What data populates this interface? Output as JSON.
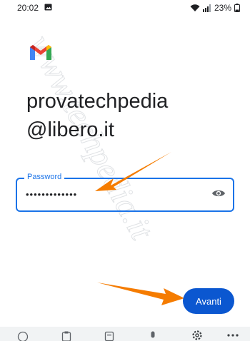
{
  "status_bar": {
    "time": "20:02",
    "battery_percent": "23%",
    "icons": [
      "image-icon",
      "wifi-icon",
      "signal-icon",
      "battery-icon"
    ]
  },
  "app": {
    "logo": "gmail-logo"
  },
  "account": {
    "line1": "provatechpedia",
    "line2": "@libero.it"
  },
  "password": {
    "label": "Password",
    "value": "•••••••••••••"
  },
  "next_button": {
    "label": "Avanti"
  },
  "keyboard_toolbar": {
    "icons": [
      "emoji-icon",
      "clipboard-icon",
      "text-tool-icon",
      "microphone-icon",
      "settings-icon",
      "more-icon"
    ]
  },
  "colors": {
    "accent": "#1a73e8",
    "button": "#0b57d0",
    "arrow": "#f57c00"
  }
}
